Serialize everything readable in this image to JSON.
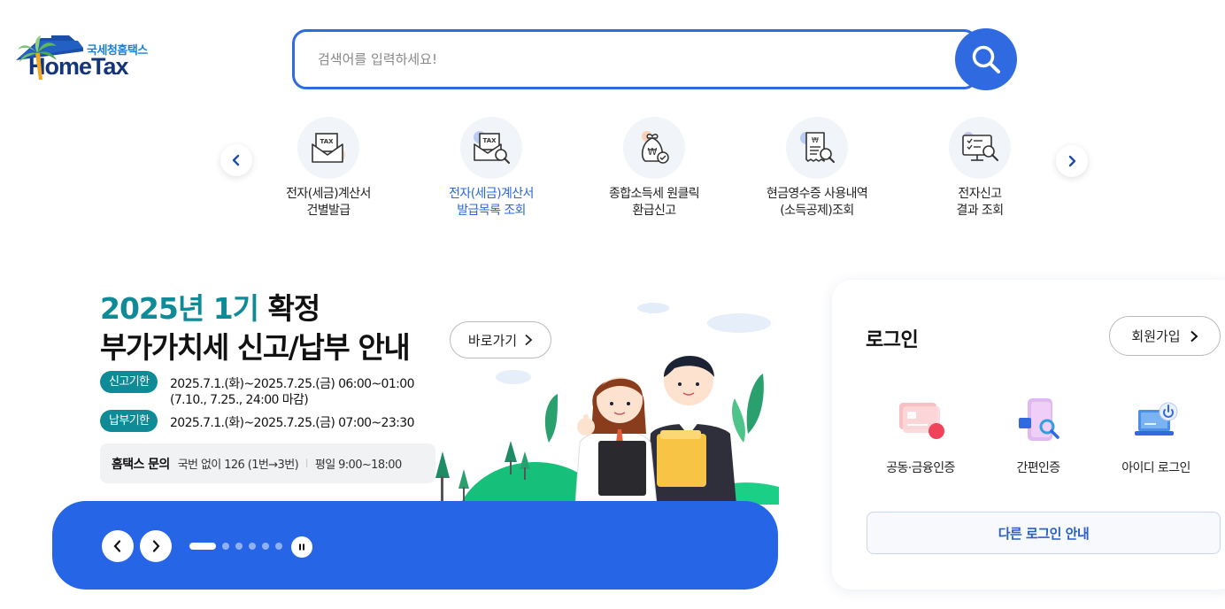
{
  "header": {
    "logo_kr": "국세청홈택스",
    "logo_en": "HomeTax",
    "search_placeholder": "검색어를 입력하세요!"
  },
  "quick_menu": {
    "items": [
      {
        "label": "전자(세금)계산서\n건별발급",
        "icon": "tax-invoice-mail-icon",
        "active": false
      },
      {
        "label": "전자(세금)계산서\n발급목록 조회",
        "icon": "tax-invoice-search-icon",
        "active": true
      },
      {
        "label": "종합소득세 원클릭\n환급신고",
        "icon": "won-refund-bag-icon",
        "active": false
      },
      {
        "label": "현금영수증 사용내역\n(소득공제)조회",
        "icon": "receipt-search-icon",
        "active": false
      },
      {
        "label": "전자신고\n결과 조회",
        "icon": "monitor-checklist-icon",
        "active": false
      }
    ]
  },
  "banner": {
    "title_highlight": "2025년 1기",
    "title_rest": " 확정",
    "title_line2": "부가가치세 신고/납부 안내",
    "goto_label": "바로가기",
    "filing_tag": "신고기한",
    "filing_line1": "2025.7.1.(화)~2025.7.25.(금) 06:00~01:00",
    "filing_line2": "(7.10., 7.25., 24:00 마감)",
    "payment_tag": "납부기한",
    "payment_line": "2025.7.1.(화)~2025.7.25.(금) 07:00~23:30",
    "inquiry_title": "홈택스 문의",
    "inquiry_phone": "국번 없이 126 (1번→3번)",
    "inquiry_hours": "평일 9:00~18:00",
    "slides_total": 6,
    "slide_current": 1
  },
  "login": {
    "title": "로그인",
    "join_label": "회원가입",
    "options": [
      {
        "label": "공동·금융인증",
        "icon": "certificate-card-icon"
      },
      {
        "label": "간편인증",
        "icon": "simple-auth-phone-icon"
      },
      {
        "label": "아이디 로그인",
        "icon": "id-login-laptop-icon"
      }
    ],
    "other_login_label": "다른 로그인 안내"
  },
  "colors": {
    "primary": "#2f6ae0",
    "banner_bar": "#2665e6",
    "teal": "#0f8a97",
    "logo_navy": "#13357a"
  }
}
